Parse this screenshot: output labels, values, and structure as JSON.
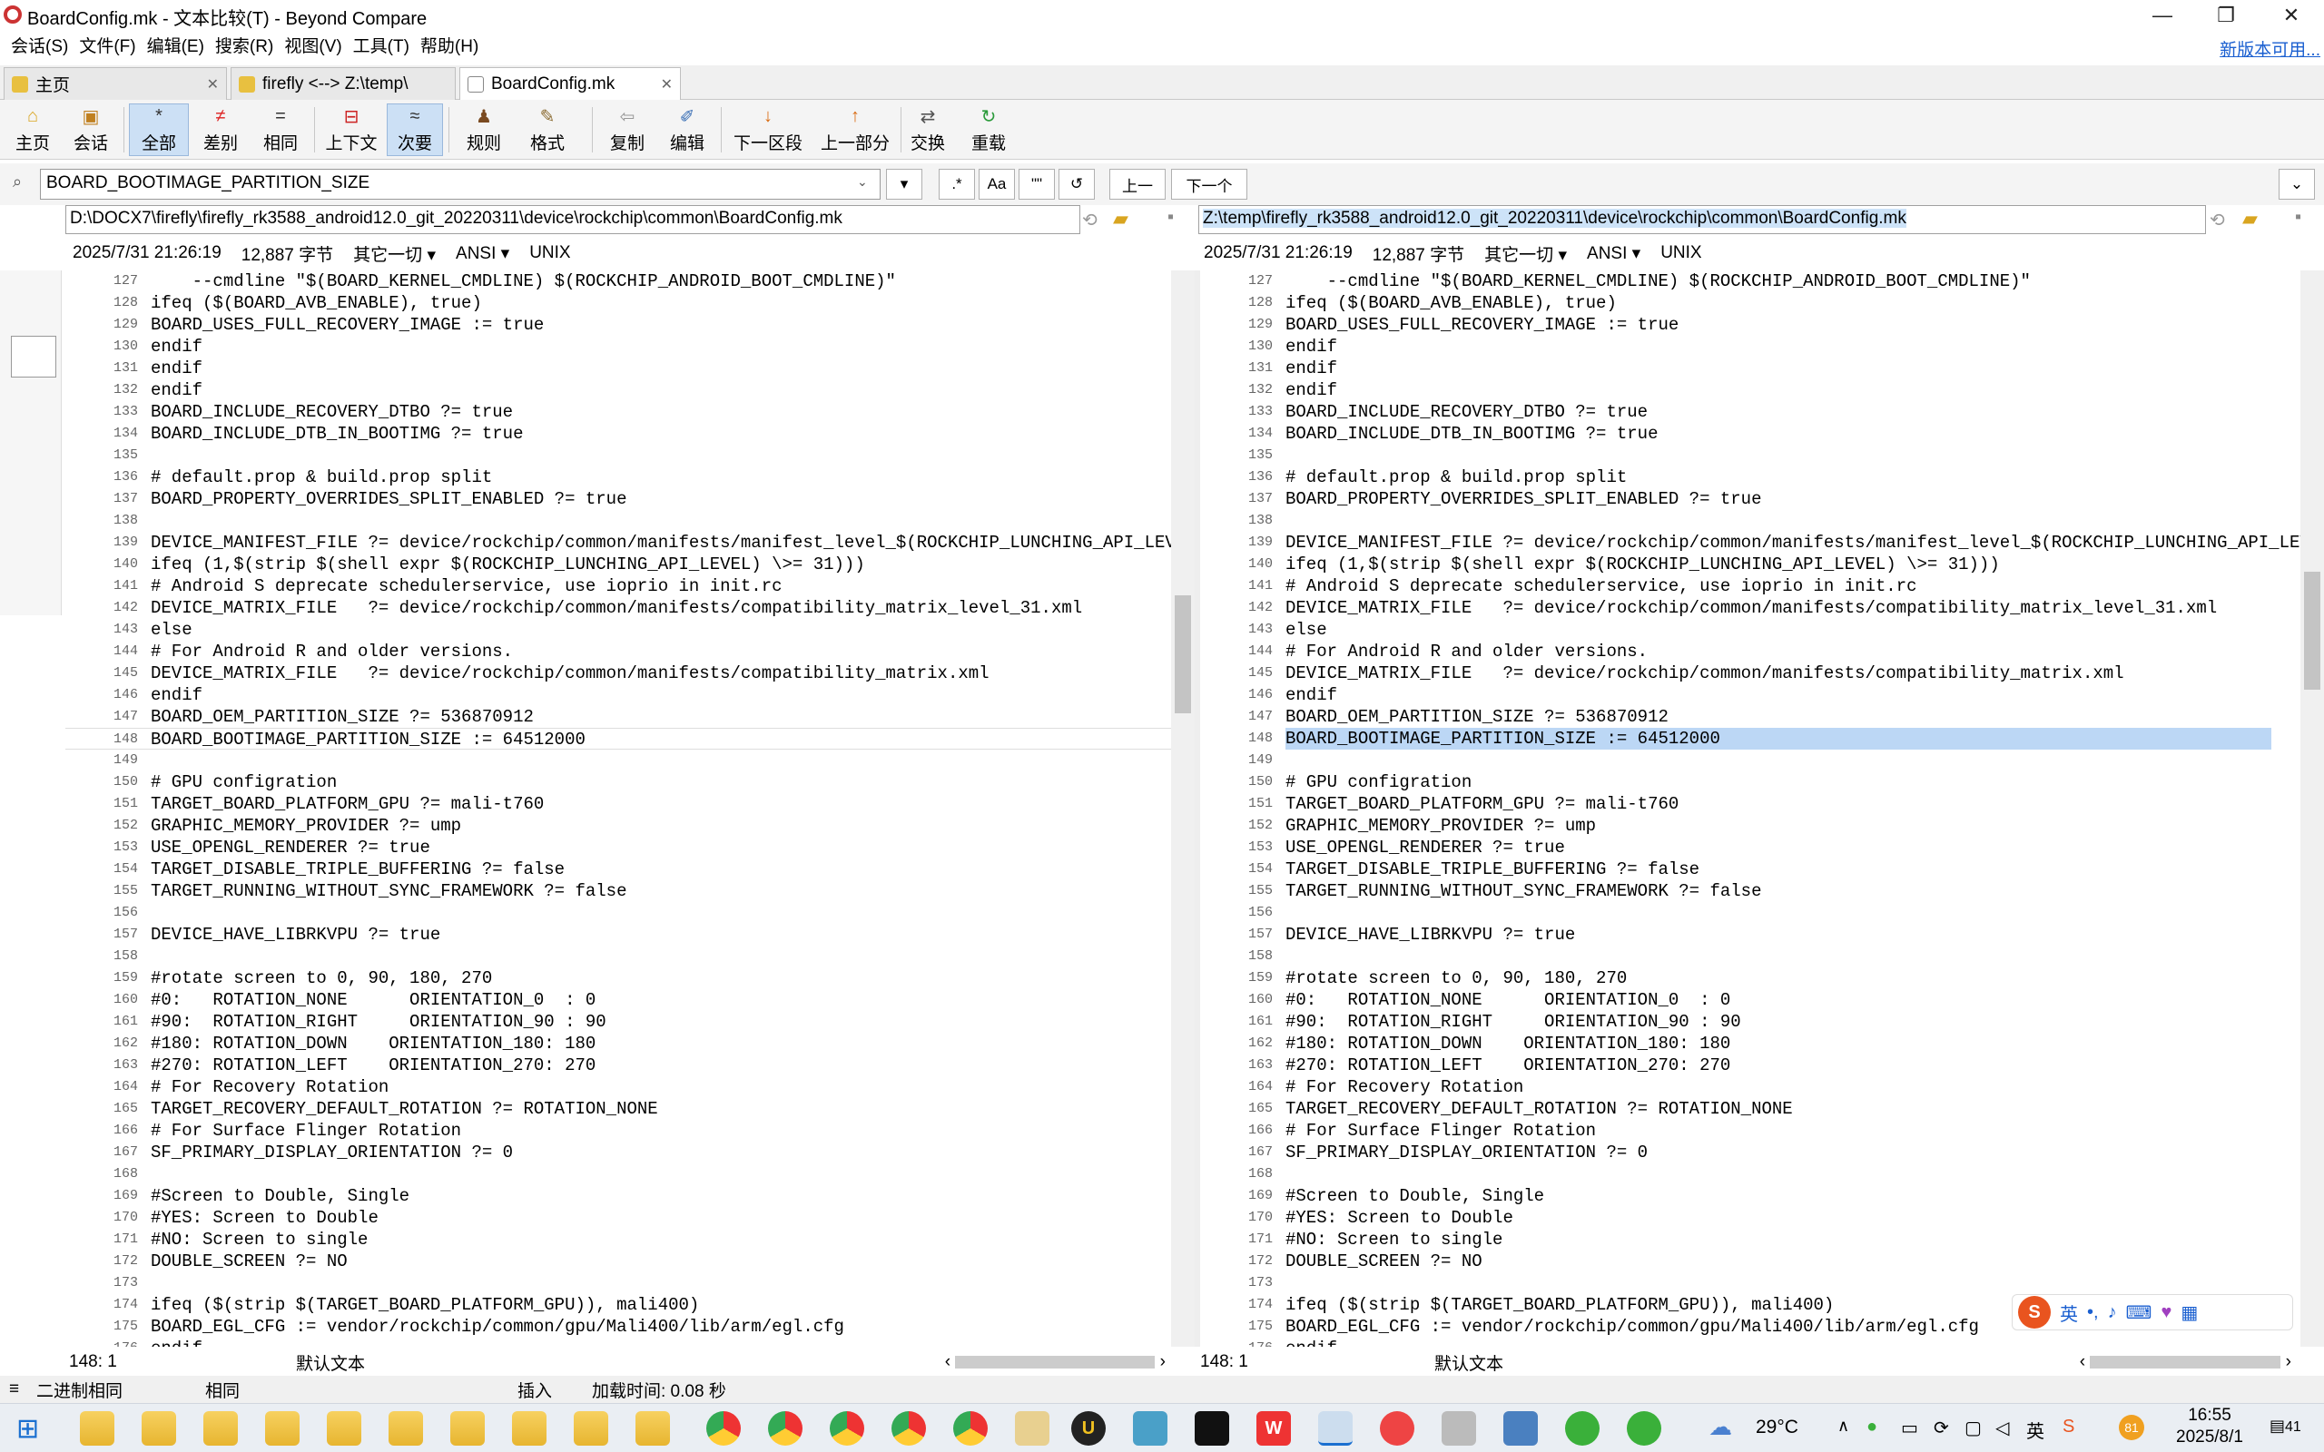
{
  "window": {
    "title": "BoardConfig.mk - 文本比较(T) - Beyond Compare",
    "min": "—",
    "max": "❐",
    "close": "✕"
  },
  "menu": [
    "会话(S)",
    "文件(F)",
    "编辑(E)",
    "搜索(R)",
    "视图(V)",
    "工具(T)",
    "帮助(H)"
  ],
  "new_version": "新版本可用...",
  "tabs": [
    {
      "label": "主页"
    },
    {
      "label": "firefly <--> Z:\\temp\\"
    },
    {
      "label": "BoardConfig.mk"
    }
  ],
  "toolbar": {
    "home": "主页",
    "session": "会话",
    "all": "全部",
    "diff": "差别",
    "same": "相同",
    "context": "上下文",
    "minor": "次要",
    "rules": "规则",
    "format": "格式",
    "copy": "复制",
    "edit": "编辑",
    "next_section": "下一区段",
    "prev_section": "上一部分",
    "swap": "交换",
    "reload": "重载"
  },
  "search": {
    "value": "BOARD_BOOTIMAGE_PARTITION_SIZE",
    "prev": "上一",
    "next": "下一个",
    "regex": ".*",
    "case": "Aa",
    "word": "\"\""
  },
  "left": {
    "path": "D:\\DOCX7\\firefly\\firefly_rk3588_android12.0_git_20220311\\device\\rockchip\\common\\BoardConfig.mk",
    "date": "2025/7/31 21:26:19",
    "size": "12,887 字节",
    "other": "其它一切",
    "encoding": "ANSI",
    "eol": "UNIX",
    "pos": "148: 1",
    "textfmt": "默认文本"
  },
  "right": {
    "path": "Z:\\temp\\firefly_rk3588_android12.0_git_20220311\\device\\rockchip\\common\\BoardConfig.mk",
    "date": "2025/7/31 21:26:19",
    "size": "12,887 字节",
    "other": "其它一切",
    "encoding": "ANSI",
    "eol": "UNIX",
    "pos": "148: 1",
    "textfmt": "默认文本"
  },
  "lines": [
    {
      "n": "127",
      "t": "    --cmdline \"$(BOARD_KERNEL_CMDLINE) $(ROCKCHIP_ANDROID_BOOT_CMDLINE)\""
    },
    {
      "n": "128",
      "t": "ifeq ($(BOARD_AVB_ENABLE), true)"
    },
    {
      "n": "129",
      "t": "BOARD_USES_FULL_RECOVERY_IMAGE := true"
    },
    {
      "n": "130",
      "t": "endif"
    },
    {
      "n": "131",
      "t": "endif"
    },
    {
      "n": "132",
      "t": "endif"
    },
    {
      "n": "133",
      "t": "BOARD_INCLUDE_RECOVERY_DTBO ?= true"
    },
    {
      "n": "134",
      "t": "BOARD_INCLUDE_DTB_IN_BOOTIMG ?= true"
    },
    {
      "n": "135",
      "t": ""
    },
    {
      "n": "136",
      "t": "# default.prop & build.prop split"
    },
    {
      "n": "137",
      "t": "BOARD_PROPERTY_OVERRIDES_SPLIT_ENABLED ?= true"
    },
    {
      "n": "138",
      "t": ""
    },
    {
      "n": "139",
      "t": "DEVICE_MANIFEST_FILE ?= device/rockchip/common/manifests/manifest_level_$(ROCKCHIP_LUNCHING_API_LEVEL).xml"
    },
    {
      "n": "140",
      "t": "ifeq (1,$(strip $(shell expr $(ROCKCHIP_LUNCHING_API_LEVEL) \\>= 31)))"
    },
    {
      "n": "141",
      "t": "# Android S deprecate schedulerservice, use ioprio in init.rc"
    },
    {
      "n": "142",
      "t": "DEVICE_MATRIX_FILE   ?= device/rockchip/common/manifests/compatibility_matrix_level_31.xml"
    },
    {
      "n": "143",
      "t": "else"
    },
    {
      "n": "144",
      "t": "# For Android R and older versions."
    },
    {
      "n": "145",
      "t": "DEVICE_MATRIX_FILE   ?= device/rockchip/common/manifests/compatibility_matrix.xml"
    },
    {
      "n": "146",
      "t": "endif"
    },
    {
      "n": "147",
      "t": "BOARD_OEM_PARTITION_SIZE ?= 536870912"
    },
    {
      "n": "148",
      "t": "BOARD_BOOTIMAGE_PARTITION_SIZE := 64512000"
    },
    {
      "n": "149",
      "t": ""
    },
    {
      "n": "150",
      "t": "# GPU configration"
    },
    {
      "n": "151",
      "t": "TARGET_BOARD_PLATFORM_GPU ?= mali-t760"
    },
    {
      "n": "152",
      "t": "GRAPHIC_MEMORY_PROVIDER ?= ump"
    },
    {
      "n": "153",
      "t": "USE_OPENGL_RENDERER ?= true"
    },
    {
      "n": "154",
      "t": "TARGET_DISABLE_TRIPLE_BUFFERING ?= false"
    },
    {
      "n": "155",
      "t": "TARGET_RUNNING_WITHOUT_SYNC_FRAMEWORK ?= false"
    },
    {
      "n": "156",
      "t": ""
    },
    {
      "n": "157",
      "t": "DEVICE_HAVE_LIBRKVPU ?= true"
    },
    {
      "n": "158",
      "t": ""
    },
    {
      "n": "159",
      "t": "#rotate screen to 0, 90, 180, 270"
    },
    {
      "n": "160",
      "t": "#0:   ROTATION_NONE      ORIENTATION_0  : 0"
    },
    {
      "n": "161",
      "t": "#90:  ROTATION_RIGHT     ORIENTATION_90 : 90"
    },
    {
      "n": "162",
      "t": "#180: ROTATION_DOWN    ORIENTATION_180: 180"
    },
    {
      "n": "163",
      "t": "#270: ROTATION_LEFT    ORIENTATION_270: 270"
    },
    {
      "n": "164",
      "t": "# For Recovery Rotation"
    },
    {
      "n": "165",
      "t": "TARGET_RECOVERY_DEFAULT_ROTATION ?= ROTATION_NONE"
    },
    {
      "n": "166",
      "t": "# For Surface Flinger Rotation"
    },
    {
      "n": "167",
      "t": "SF_PRIMARY_DISPLAY_ORIENTATION ?= 0"
    },
    {
      "n": "168",
      "t": ""
    },
    {
      "n": "169",
      "t": "#Screen to Double, Single"
    },
    {
      "n": "170",
      "t": "#YES: Screen to Double"
    },
    {
      "n": "171",
      "t": "#NO: Screen to single"
    },
    {
      "n": "172",
      "t": "DOUBLE_SCREEN ?= NO"
    },
    {
      "n": "173",
      "t": ""
    },
    {
      "n": "174",
      "t": "ifeq ($(strip $(TARGET_BOARD_PLATFORM_GPU)), mali400)"
    },
    {
      "n": "175",
      "t": "BOARD_EGL_CFG := vendor/rockchip/common/gpu/Mali400/lib/arm/egl.cfg"
    },
    {
      "n": "176",
      "t": "endif"
    }
  ],
  "status": {
    "binary": "二进制相同",
    "same": "相同",
    "insert": "插入",
    "load_time": "加载时间: 0.08 秒"
  },
  "taskbar": {
    "weather": "29°C",
    "time": "16:55",
    "date": "2025/8/1",
    "ime": "英",
    "notif": "41",
    "badge": "81"
  }
}
